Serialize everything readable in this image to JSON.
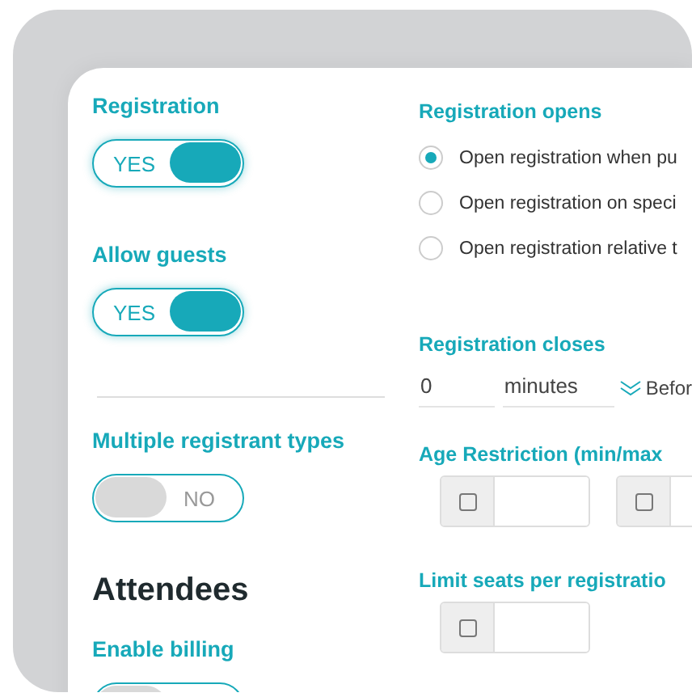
{
  "left": [
    {
      "kind": "toggle",
      "label": "Registration",
      "on": true,
      "toggle_text": "YES"
    },
    {
      "kind": "toggle",
      "label": "Allow guests",
      "on": true,
      "toggle_text": "YES"
    },
    {
      "kind": "divider"
    },
    {
      "kind": "toggle",
      "label": "Multiple registrant types",
      "on": false,
      "toggle_text": "NO"
    },
    {
      "kind": "heading",
      "text": "Attendees"
    },
    {
      "kind": "toggle",
      "label": "Enable billing",
      "on": false
    }
  ],
  "registration_opens": {
    "label": "Registration opens",
    "options": [
      {
        "label": "Open registration when pu",
        "selected": true
      },
      {
        "label": "Open registration on speci",
        "selected": false
      },
      {
        "label": "Open registration relative t",
        "selected": false
      }
    ]
  },
  "registration_closes": {
    "label": "Registration closes",
    "amount": "0",
    "unit": "minutes",
    "relation": "Befor"
  },
  "age_restriction": {
    "label": "Age Restriction (min/max",
    "fields": [
      {
        "checked": false
      },
      {
        "checked": false
      }
    ]
  },
  "limit_seats": {
    "label": "Limit seats per registratio",
    "fields": [
      {
        "checked": false
      }
    ]
  }
}
